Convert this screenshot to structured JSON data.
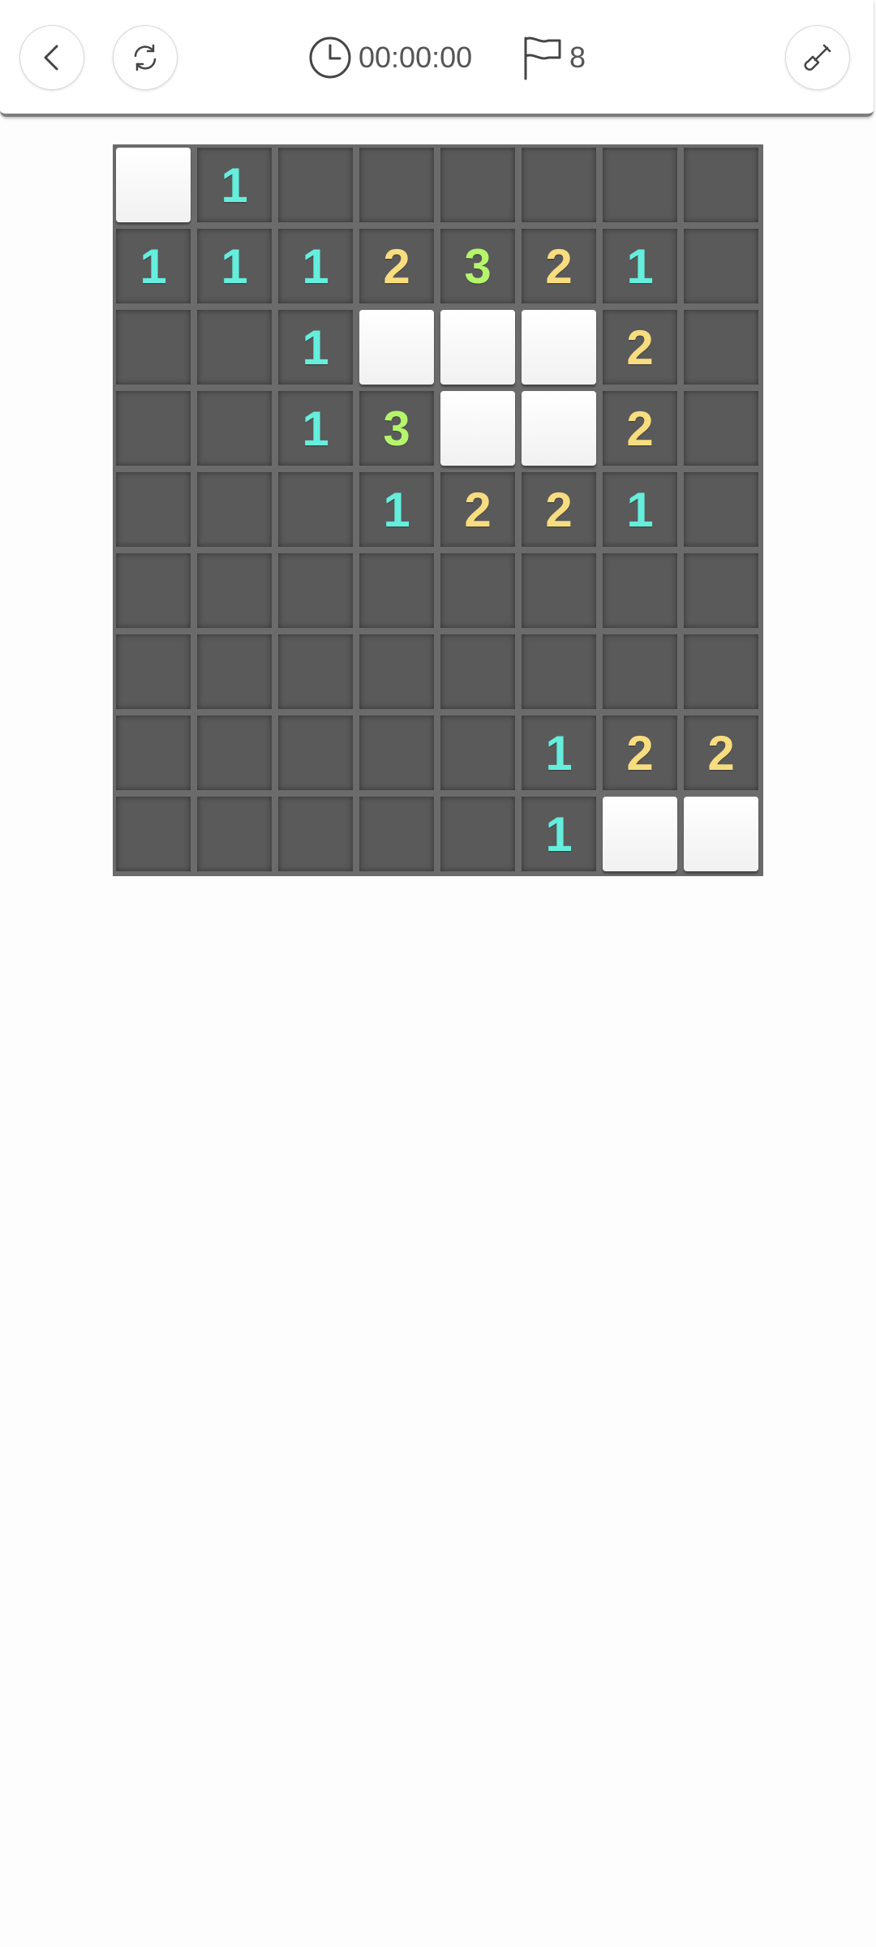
{
  "header": {
    "back_icon": "chevron-left-icon",
    "restart_icon": "refresh-icon",
    "timer": "00:00:00",
    "timer_icon": "clock-icon",
    "flags": "8",
    "flag_icon": "flag-icon",
    "tool_icon": "shovel-icon"
  },
  "colors": {
    "one": "#66eedd",
    "two": "#f7dd7f",
    "three": "#b5f56c",
    "revealed_cell": "#5a5a5a",
    "hidden_cell": "#ffffff",
    "grid": "#6b6b6b"
  },
  "board": {
    "cols": 8,
    "rows": 9,
    "cells": [
      [
        "H",
        "1",
        "0",
        "0",
        "0",
        "0",
        "0",
        "0"
      ],
      [
        "1",
        "1",
        "1",
        "2",
        "3",
        "2",
        "1",
        "0"
      ],
      [
        "0",
        "0",
        "1",
        "H",
        "H",
        "H",
        "2",
        "0"
      ],
      [
        "0",
        "0",
        "1",
        "3",
        "H",
        "H",
        "2",
        "0"
      ],
      [
        "0",
        "0",
        "0",
        "1",
        "2",
        "2",
        "1",
        "0"
      ],
      [
        "0",
        "0",
        "0",
        "0",
        "0",
        "0",
        "0",
        "0"
      ],
      [
        "0",
        "0",
        "0",
        "0",
        "0",
        "0",
        "0",
        "0"
      ],
      [
        "0",
        "0",
        "0",
        "0",
        "0",
        "1",
        "2",
        "2"
      ],
      [
        "0",
        "0",
        "0",
        "0",
        "0",
        "1",
        "H",
        "H"
      ]
    ]
  }
}
